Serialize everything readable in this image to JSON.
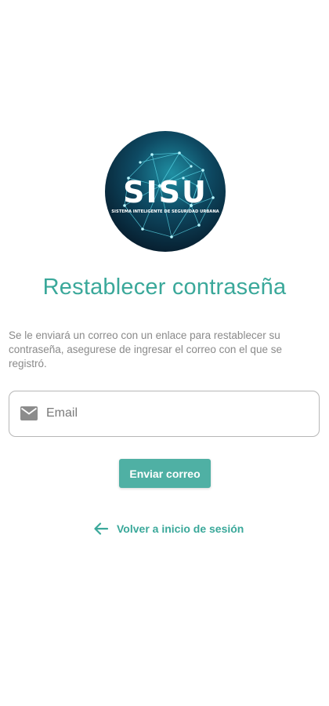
{
  "logo": {
    "text": "SISU",
    "subtitle": "SISTEMA INTELIGENTE DE SEGURIDAD URBANA",
    "icon": "globe-network-logo"
  },
  "screen": {
    "title": "Restablecer contraseña",
    "description": "Se le enviará un correo con un enlace para restablecer su contraseña, asegurese de ingresar el correo con el que se registró."
  },
  "email": {
    "placeholder": "Email",
    "value": "",
    "icon": "mail-icon"
  },
  "actions": {
    "send_label": "Enviar correo",
    "back_label": "Volver a inicio de sesión",
    "back_icon": "arrow-left-icon"
  },
  "colors": {
    "accent": "#3aa89a",
    "button": "#4fb0a4",
    "text_muted": "#8a8a8a"
  }
}
